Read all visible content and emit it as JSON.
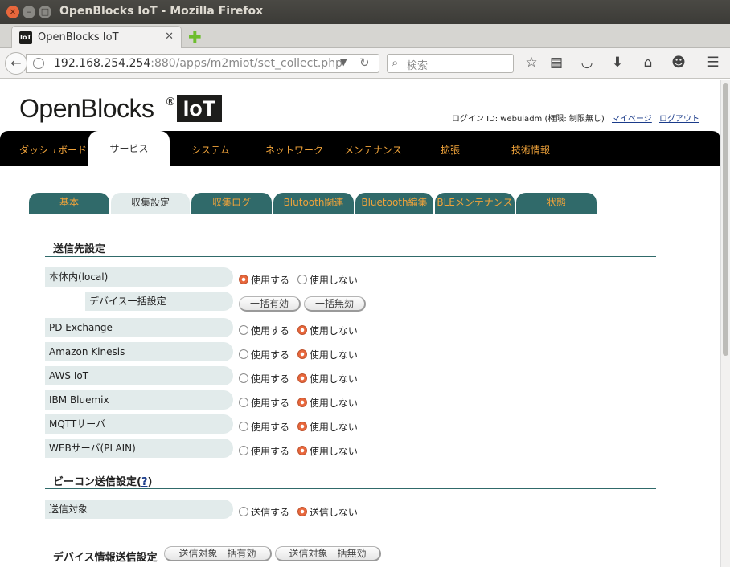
{
  "window": {
    "title": "OpenBlocks IoT - Mozilla Firefox"
  },
  "browser": {
    "tab_title": "OpenBlocks IoT",
    "tab_favicon": "IoT",
    "url_host": "192.168.254.254",
    "url_rest": ":880/apps/m2miot/set_collect.php",
    "search_placeholder": "検索"
  },
  "logo": {
    "text": "OpenBlocks",
    "reg": "®",
    "badge": "IoT"
  },
  "login": {
    "text": "ログイン ID: webuiadm (権限: 制限無し)",
    "mypage": "マイページ",
    "logout": "ログアウト"
  },
  "mainnav": {
    "items": [
      "ダッシュボード",
      "サービス",
      "システム",
      "ネットワーク",
      "メンテナンス",
      "拡張",
      "技術情報"
    ],
    "active": "サービス"
  },
  "subtabs": [
    "基本",
    "収集設定",
    "収集ログ",
    "Blutooth関連",
    "Bluetooth編集",
    "BLEメンテナンス",
    "状態"
  ],
  "section1": {
    "title": "送信先設定",
    "rows": [
      {
        "label": "本体内(local)",
        "opt1": "使用する",
        "opt2": "使用しない",
        "selected": 1
      },
      {
        "label": "PD Exchange",
        "opt1": "使用する",
        "opt2": "使用しない",
        "selected": 2
      },
      {
        "label": "Amazon Kinesis",
        "opt1": "使用する",
        "opt2": "使用しない",
        "selected": 2
      },
      {
        "label": "AWS IoT",
        "opt1": "使用する",
        "opt2": "使用しない",
        "selected": 2
      },
      {
        "label": "IBM Bluemix",
        "opt1": "使用する",
        "opt2": "使用しない",
        "selected": 2
      },
      {
        "label": "MQTTサーバ",
        "opt1": "使用する",
        "opt2": "使用しない",
        "selected": 2
      },
      {
        "label": "WEBサーバ(PLAIN)",
        "opt1": "使用する",
        "opt2": "使用しない",
        "selected": 2
      }
    ],
    "device_bulk": {
      "label": "デバイス一括設定",
      "enable": "一括有効",
      "disable": "一括無効"
    }
  },
  "section2": {
    "title": "ビーコン送信設定",
    "help_open": "(",
    "help": "?",
    "help_close": ")",
    "row": {
      "label": "送信対象",
      "opt1": "送信する",
      "opt2": "送信しない",
      "selected": 2
    }
  },
  "section3": {
    "title": "デバイス情報送信設定",
    "enable": "送信対象一括有効",
    "disable": "送信対象一括無効"
  },
  "colors": {
    "nav_bg": "#000000",
    "nav_text": "#f0a33a",
    "tab_bg": "#306a6a",
    "label_bg": "#e2ebeb",
    "radio_on": "#e8673c"
  }
}
